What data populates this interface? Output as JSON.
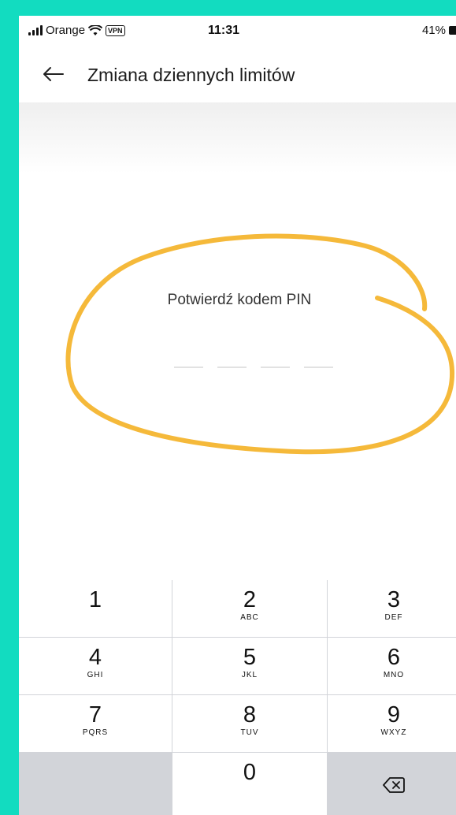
{
  "status_bar": {
    "carrier": "Orange",
    "vpn": "VPN",
    "time": "11:31",
    "battery": "41%"
  },
  "header": {
    "title": "Zmiana dziennych limitów",
    "back_icon": "arrow-left-icon"
  },
  "pin": {
    "label": "Potwierdź kodem PIN",
    "digits_entered": 0,
    "length": 4
  },
  "keypad": {
    "keys": [
      {
        "digit": "1",
        "letters": ""
      },
      {
        "digit": "2",
        "letters": "ABC"
      },
      {
        "digit": "3",
        "letters": "DEF"
      },
      {
        "digit": "4",
        "letters": "GHI"
      },
      {
        "digit": "5",
        "letters": "JKL"
      },
      {
        "digit": "6",
        "letters": "MNO"
      },
      {
        "digit": "7",
        "letters": "PQRS"
      },
      {
        "digit": "8",
        "letters": "TUV"
      },
      {
        "digit": "9",
        "letters": "WXYZ"
      },
      {
        "digit": "0",
        "letters": ""
      }
    ],
    "delete_icon": "backspace-icon"
  },
  "colors": {
    "background": "#12dcc0",
    "annotation": "#f5b93a",
    "keypad_bg": "#d2d4d9"
  }
}
